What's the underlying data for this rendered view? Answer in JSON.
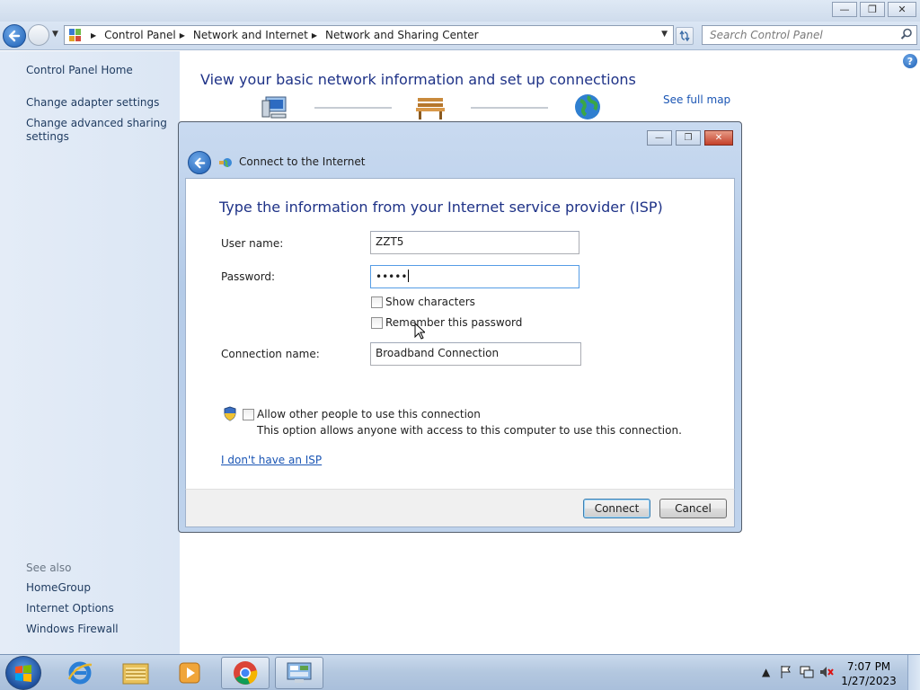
{
  "window": {
    "minimize_glyph": "—",
    "maximize_glyph": "❐",
    "close_glyph": "✕"
  },
  "address": {
    "breadcrumbs": [
      "Control Panel",
      "Network and Internet",
      "Network and Sharing Center"
    ],
    "search_placeholder": "Search Control Panel"
  },
  "sidebar": {
    "links": [
      {
        "label": "Control Panel Home"
      },
      {
        "label": "Change adapter settings"
      },
      {
        "label": "Change advanced sharing settings"
      }
    ],
    "see_also_label": "See also",
    "see_also": [
      {
        "label": "HomeGroup"
      },
      {
        "label": "Internet Options"
      },
      {
        "label": "Windows Firewall"
      }
    ]
  },
  "main": {
    "heading": "View your basic network information and set up connections",
    "see_full_map": "See full map"
  },
  "dialog": {
    "title": "Connect to the Internet",
    "heading": "Type the information from your Internet service provider (ISP)",
    "username_label": "User name:",
    "username_value": "ZZT5",
    "password_label": "Password:",
    "password_value": "•••••",
    "show_characters_label": "Show characters",
    "show_characters_checked": false,
    "remember_password_label": "Remember this password",
    "remember_password_checked": false,
    "connection_name_label": "Connection name:",
    "connection_name_value": "Broadband Connection",
    "allow_others_label": "Allow other people to use this connection",
    "allow_others_checked": false,
    "allow_others_note": "This option allows anyone with access to this computer to use this connection.",
    "no_isp_link": "I don't have an ISP",
    "connect_button": "Connect",
    "cancel_button": "Cancel"
  },
  "taskbar": {
    "apps": [
      "internet-explorer",
      "windows-explorer",
      "media-player",
      "chrome",
      "control-panel"
    ],
    "time": "7:07 PM",
    "date": "1/27/2023"
  },
  "colors": {
    "heading_blue": "#1e3287",
    "link_blue": "#1a55b4",
    "sidebar_bg": "#dfe8f5",
    "taskbar_bg": "#b3c7df"
  }
}
